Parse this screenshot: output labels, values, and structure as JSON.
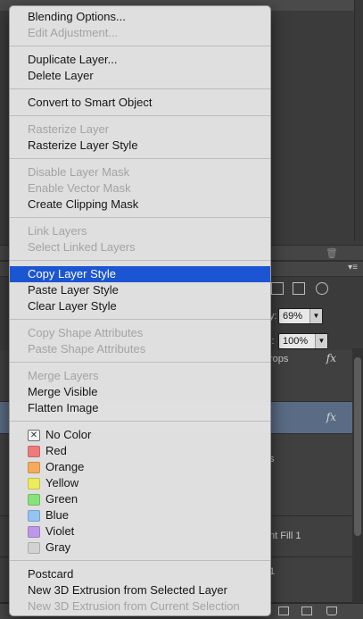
{
  "menu": {
    "groups": [
      {
        "items": [
          {
            "label": "Blending Options...",
            "enabled": true
          },
          {
            "label": "Edit Adjustment...",
            "enabled": false
          }
        ]
      },
      {
        "items": [
          {
            "label": "Duplicate Layer...",
            "enabled": true
          },
          {
            "label": "Delete Layer",
            "enabled": true
          }
        ]
      },
      {
        "items": [
          {
            "label": "Convert to Smart Object",
            "enabled": true
          }
        ]
      },
      {
        "items": [
          {
            "label": "Rasterize Layer",
            "enabled": false
          },
          {
            "label": "Rasterize Layer Style",
            "enabled": true
          }
        ]
      },
      {
        "items": [
          {
            "label": "Disable Layer Mask",
            "enabled": false
          },
          {
            "label": "Enable Vector Mask",
            "enabled": false
          },
          {
            "label": "Create Clipping Mask",
            "enabled": true
          }
        ]
      },
      {
        "items": [
          {
            "label": "Link Layers",
            "enabled": false
          },
          {
            "label": "Select Linked Layers",
            "enabled": false
          }
        ]
      },
      {
        "items": [
          {
            "label": "Copy Layer Style",
            "enabled": true,
            "highlighted": true
          },
          {
            "label": "Paste Layer Style",
            "enabled": true
          },
          {
            "label": "Clear Layer Style",
            "enabled": true
          }
        ]
      },
      {
        "items": [
          {
            "label": "Copy Shape Attributes",
            "enabled": false
          },
          {
            "label": "Paste Shape Attributes",
            "enabled": false
          }
        ]
      },
      {
        "items": [
          {
            "label": "Merge Layers",
            "enabled": false
          },
          {
            "label": "Merge Visible",
            "enabled": true
          },
          {
            "label": "Flatten Image",
            "enabled": true
          }
        ]
      }
    ],
    "colors": [
      {
        "label": "No Color",
        "swatch": "none"
      },
      {
        "label": "Red",
        "swatch": "#f07a7a"
      },
      {
        "label": "Orange",
        "swatch": "#f5ac5a"
      },
      {
        "label": "Yellow",
        "swatch": "#ecec5c"
      },
      {
        "label": "Green",
        "swatch": "#88e27c"
      },
      {
        "label": "Blue",
        "swatch": "#93c4f2"
      },
      {
        "label": "Violet",
        "swatch": "#bd98e8"
      },
      {
        "label": "Gray",
        "swatch": "#d2d2d2"
      }
    ],
    "extras": [
      {
        "label": "Postcard",
        "enabled": true
      },
      {
        "label": "New 3D Extrusion from Selected Layer",
        "enabled": true
      },
      {
        "label": "New 3D Extrusion from Current Selection",
        "enabled": false
      }
    ]
  },
  "background_panel": {
    "opacity_value": "69%",
    "fill_value": "100%",
    "opacity_suffix": "y:",
    "fill_suffix": "l:",
    "row_labels": [
      "rops",
      "s",
      "nt Fill 1",
      "1"
    ],
    "fx": "fx"
  }
}
